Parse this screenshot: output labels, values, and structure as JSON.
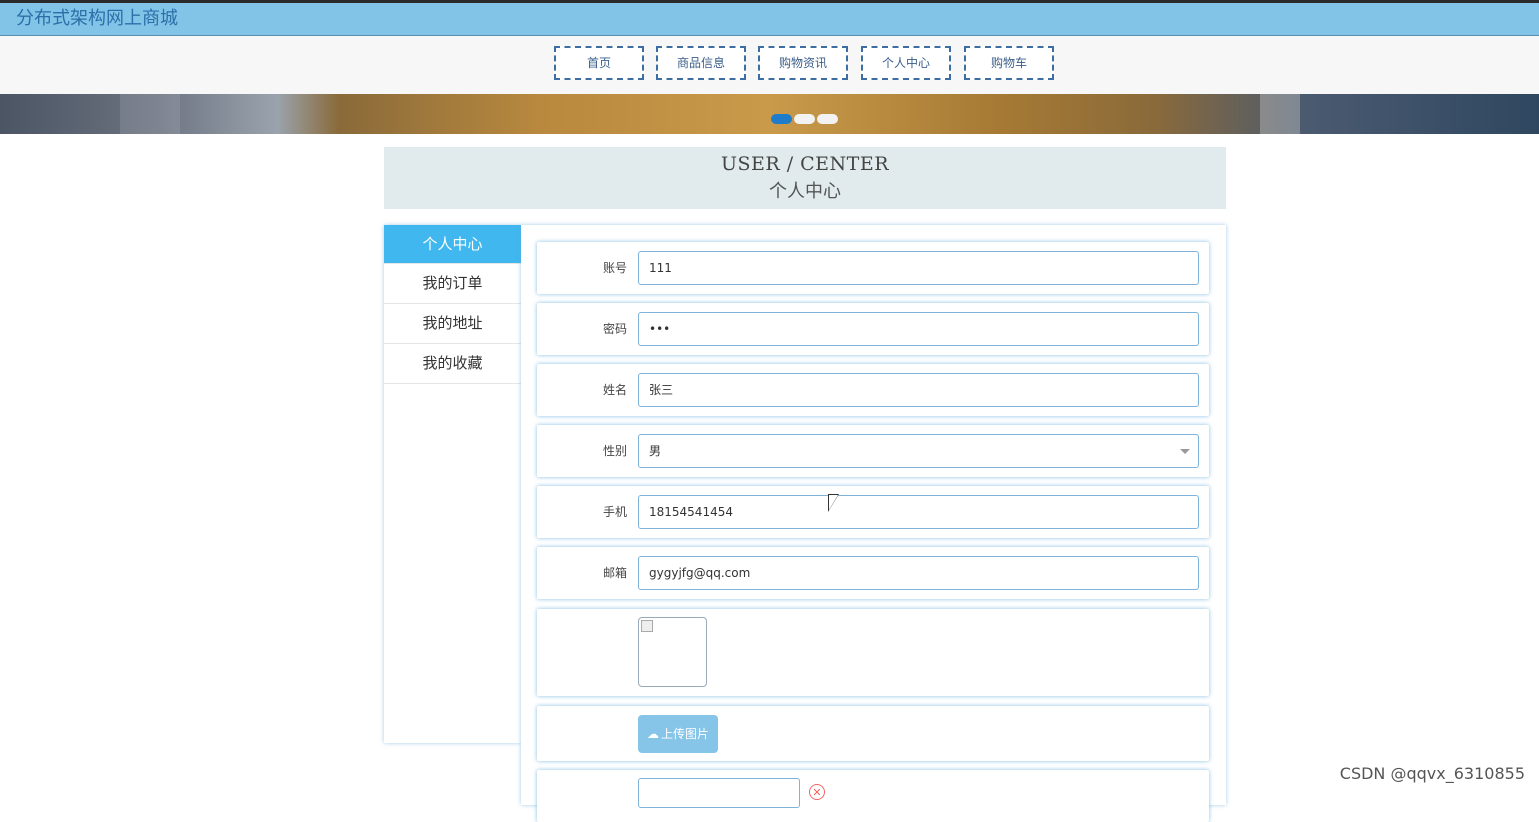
{
  "header": {
    "site_title": "分布式架构网上商城"
  },
  "nav": {
    "items": [
      {
        "label": "首页"
      },
      {
        "label": "商品信息"
      },
      {
        "label": "购物资讯"
      },
      {
        "label": "个人中心"
      },
      {
        "label": "购物车"
      }
    ]
  },
  "carousel": {
    "slide_count": 3,
    "active_index": 0
  },
  "section": {
    "title_en": "USER / CENTER",
    "title_cn": "个人中心"
  },
  "sidebar": {
    "items": [
      {
        "label": "个人中心",
        "active": true
      },
      {
        "label": "我的订单",
        "active": false
      },
      {
        "label": "我的地址",
        "active": false
      },
      {
        "label": "我的收藏",
        "active": false
      }
    ]
  },
  "form": {
    "account": {
      "label": "账号",
      "value": "111"
    },
    "password": {
      "label": "密码",
      "value": "•••"
    },
    "name": {
      "label": "姓名",
      "value": "张三"
    },
    "gender": {
      "label": "性别",
      "value": "男"
    },
    "phone": {
      "label": "手机",
      "value": "18154541454"
    },
    "email": {
      "label": "邮箱",
      "value": "gygyjfg@qq.com"
    },
    "upload_button": "上传图片"
  },
  "watermark": "CSDN @qqvx_6310855",
  "colors": {
    "topbar": "#82c4e8",
    "nav_border": "#3d6ea3",
    "sidebar_active": "#40b7ef",
    "upload_button": "#86c4e8"
  }
}
